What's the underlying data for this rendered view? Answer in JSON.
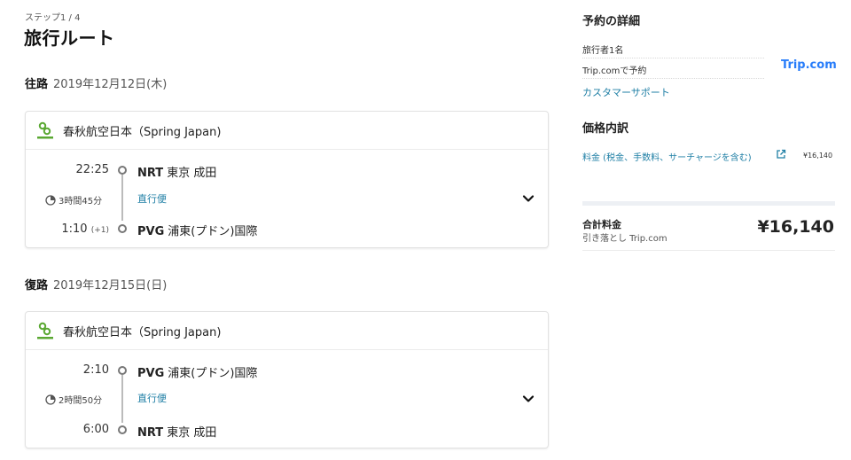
{
  "header": {
    "step": "ステップ1 / 4",
    "title": "旅行ルート"
  },
  "outbound": {
    "label": "往路",
    "date": "2019年12月12日(木)",
    "airline": "春秋航空日本（Spring Japan)",
    "depart_time": "22:25",
    "depart_code": "NRT",
    "depart_airport": "東京 成田",
    "duration": "3時間45分",
    "nonstop": "直行便",
    "arrive_time": "1:10",
    "arrive_day_offset": "(+1)",
    "arrive_code": "PVG",
    "arrive_airport": "浦東(プドン)国際"
  },
  "inbound": {
    "label": "復路",
    "date": "2019年12月15日(日)",
    "airline": "春秋航空日本（Spring Japan)",
    "depart_time": "2:10",
    "depart_code": "PVG",
    "depart_airport": "浦東(プドン)国際",
    "duration": "2時間50分",
    "nonstop": "直行便",
    "arrive_time": "6:00",
    "arrive_code": "NRT",
    "arrive_airport": "東京 成田"
  },
  "sidebar": {
    "details_title": "予約の詳細",
    "travelers": "旅行者1名",
    "booked_via": "Trip.comで予約",
    "trip_logo": "Trip.com",
    "support_link": "カスタマーサポート",
    "price_title": "価格内訳",
    "fee_label": "料金 (税金、手数料、サーチャージを含む)",
    "fee_amount": "¥16,140",
    "total_label": "合計料金",
    "total_sub": "引き落とし Trip.com",
    "total_amount": "¥16,140"
  },
  "colors": {
    "link": "#1f7fa5",
    "brand_trip": "#287dfa",
    "spring_green": "#5aa832"
  },
  "icons": [
    "spring-japan-logo",
    "clock-icon",
    "chevron-down-icon",
    "external-link-icon"
  ]
}
